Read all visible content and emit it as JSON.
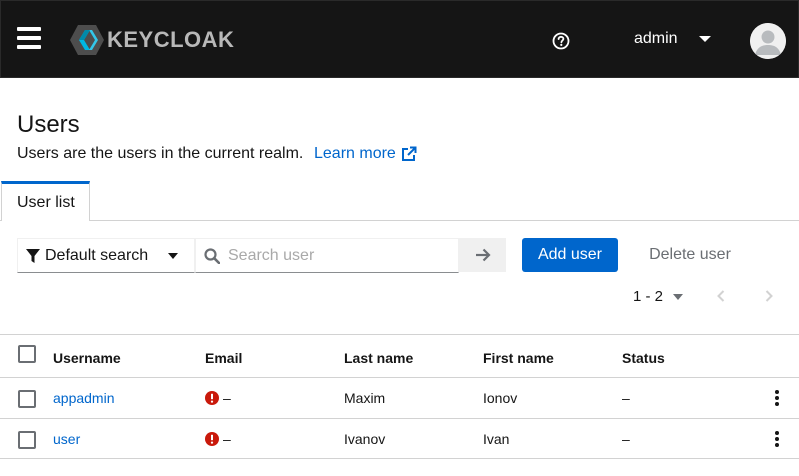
{
  "masthead": {
    "brand": "KEYCLOAK",
    "user_name": "admin"
  },
  "page": {
    "title": "Users",
    "description": "Users are the users in the current realm.",
    "learn_more": "Learn more"
  },
  "tabs": [
    {
      "label": "User list",
      "active": true
    }
  ],
  "toolbar": {
    "search_type": "Default search",
    "search_placeholder": "Search user",
    "add_user": "Add user",
    "delete_user": "Delete user"
  },
  "pagination": {
    "range": "1 - 2"
  },
  "table": {
    "columns": [
      "Username",
      "Email",
      "Last name",
      "First name",
      "Status"
    ],
    "rows": [
      {
        "username": "appadmin",
        "email": "–",
        "email_warning": true,
        "last_name": "Maxim",
        "first_name": "Ionov",
        "status": "–"
      },
      {
        "username": "user",
        "email": "–",
        "email_warning": true,
        "last_name": "Ivanov",
        "first_name": "Ivan",
        "status": "–"
      }
    ]
  },
  "colors": {
    "masthead_bg": "#151515",
    "primary": "#0066cc",
    "warning_icon": "#c9190b"
  },
  "icons": [
    "menu-icon",
    "keycloak-logo-icon",
    "help-icon",
    "caret-down-icon",
    "avatar-icon",
    "external-link-icon",
    "filter-icon",
    "search-icon",
    "arrow-right-icon",
    "angle-left-icon",
    "angle-right-icon",
    "exclamation-circle-icon",
    "kebab-icon"
  ]
}
